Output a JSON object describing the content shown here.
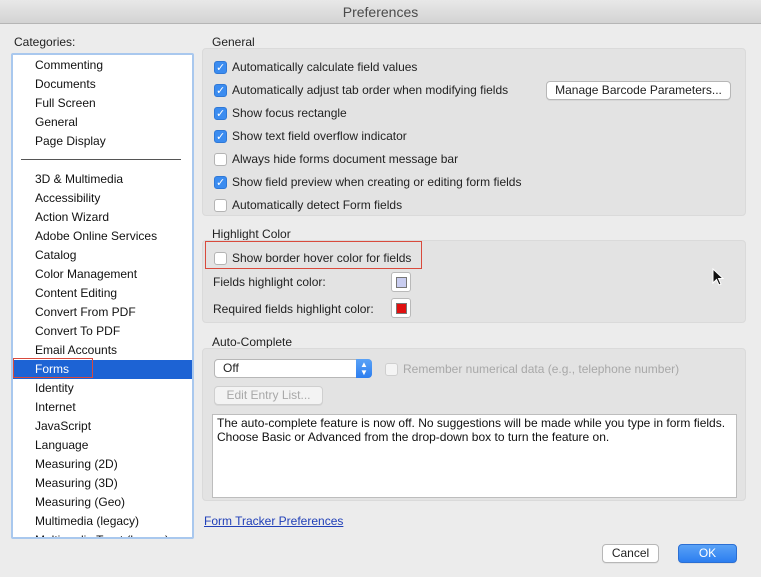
{
  "window": {
    "title": "Preferences"
  },
  "categories": {
    "label": "Categories:",
    "top_items": [
      "Commenting",
      "Documents",
      "Full Screen",
      "General",
      "Page Display"
    ],
    "items": [
      "3D & Multimedia",
      "Accessibility",
      "Action Wizard",
      "Adobe Online Services",
      "Catalog",
      "Color Management",
      "Content Editing",
      "Convert From PDF",
      "Convert To PDF",
      "Email Accounts",
      "Forms",
      "Identity",
      "Internet",
      "JavaScript",
      "Language",
      "Measuring (2D)",
      "Measuring (3D)",
      "Measuring (Geo)",
      "Multimedia (legacy)",
      "Multimedia Trust (legacy)"
    ],
    "selected": "Forms"
  },
  "general": {
    "title": "General",
    "options": [
      {
        "label": "Automatically calculate field values",
        "checked": true
      },
      {
        "label": "Automatically adjust tab order when modifying fields",
        "checked": true
      },
      {
        "label": "Show focus rectangle",
        "checked": true
      },
      {
        "label": "Show text field overflow indicator",
        "checked": true
      },
      {
        "label": "Always hide forms document message bar",
        "checked": false
      },
      {
        "label": "Show field preview when creating or editing form fields",
        "checked": true
      },
      {
        "label": "Automatically detect Form fields",
        "checked": false
      }
    ],
    "barcode_button": "Manage Barcode Parameters..."
  },
  "highlight": {
    "title": "Highlight Color",
    "hover_label": "Show border hover color for fields",
    "hover_checked": false,
    "fields_label": "Fields highlight color:",
    "fields_color": "#c9cdf0",
    "required_label": "Required fields highlight color:",
    "required_color": "#e01010"
  },
  "autocomplete": {
    "title": "Auto-Complete",
    "mode": "Off",
    "remember_label": "Remember numerical data (e.g., telephone number)",
    "edit_button": "Edit Entry List...",
    "description": "The auto-complete feature is now off. No suggestions will be made while you type in form fields. Choose Basic or Advanced from the drop-down box to turn the feature on."
  },
  "footer": {
    "link": "Form Tracker Preferences",
    "cancel": "Cancel",
    "ok": "OK"
  }
}
